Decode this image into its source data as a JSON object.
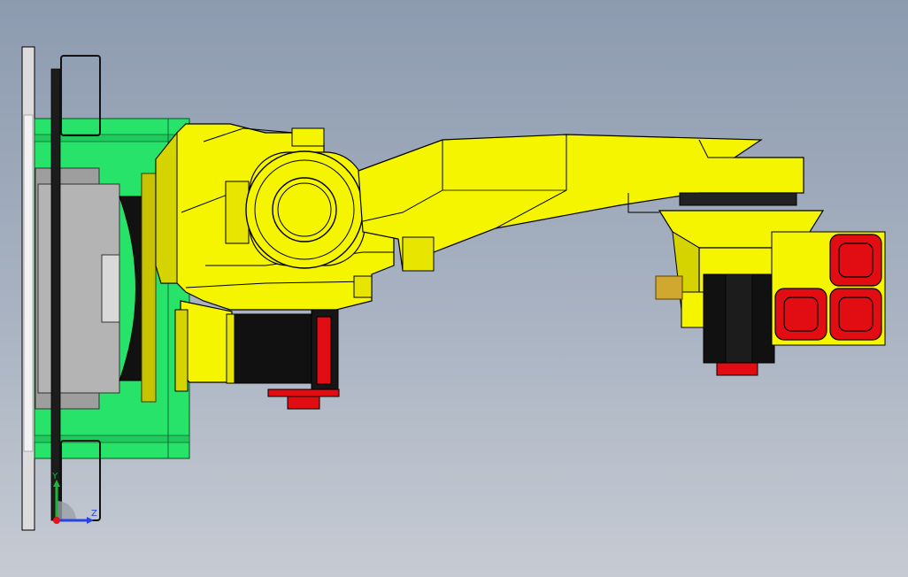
{
  "viewport": {
    "background_top": "#8d9bb0",
    "background_bottom": "#c6cbd3"
  },
  "model": {
    "colors": {
      "robot_body": "#f5f500",
      "robot_shade": "#d6d400",
      "base_plate": "#27e36a",
      "motor_housing": "#111111",
      "motor_cap": "#e10d12",
      "mount_block": "#b4b4b4",
      "wall_panel": "#dcdcdc",
      "outline": "#000000"
    }
  },
  "triad": {
    "y_label": "Y",
    "z_label": "Z",
    "y_color": "#22b23a",
    "z_color": "#2a43e0",
    "origin_color": "#e0141a"
  }
}
